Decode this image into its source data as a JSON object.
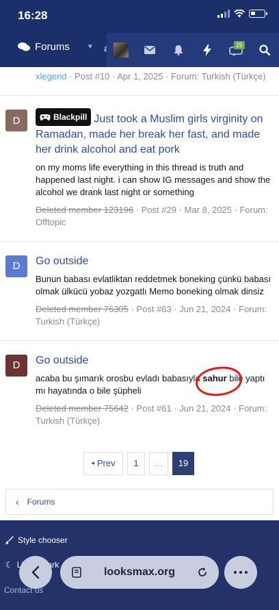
{
  "status": {
    "time": "16:28"
  },
  "nav": {
    "forums_label": "Forums",
    "extra_char": "a",
    "badge_count": "25"
  },
  "prev_post": {
    "user": "xlegend",
    "meta": " · Post #10 · Apr 1, 2025 · Forum: Turkish (Türkçe)"
  },
  "posts": [
    {
      "avatar_letter": "D",
      "avatar_color": "#8a6a5e",
      "prefix_label": "Blackpill",
      "title": "Just took a Muslim girls virginity on Ramadan, made her break her fast, and made her drink alcohol and eat pork",
      "snippet": "on my moms life everything in this thread is truth and happened last night. i can show IG messages and show the alcohol we drank last night or something",
      "author": "Deleted member 123196",
      "meta": " · Post #29 · Mar 8, 2025 · Forum: Offtopic"
    },
    {
      "avatar_letter": "D",
      "avatar_color": "#5a7bd0",
      "title": "Go outside",
      "snippet": "Bunun babası evlatliktan reddetmek boneking çünkü babası olmak ülkücü yobaz yozgatlı Memo boneking olmak dinsiz",
      "author": "Deleted member 76305",
      "meta": " · Post #63 · Jun 21, 2024 · Forum: Turkish (Türkçe)"
    },
    {
      "avatar_letter": "D",
      "avatar_color": "#6b3430",
      "title": "Go outside",
      "snippet_before": "acaba bu şımarık orosbu evladı babasıyla ",
      "snippet_highlight": "sahur",
      "snippet_after": " bile yaptı mı hayatında o bile şüpheli",
      "author": "Deleted member 75642",
      "meta": " · Post #61 · Jun 21, 2024 · Forum: Turkish (Türkçe)"
    }
  ],
  "pagination": {
    "prev": "Prev",
    "first": "1",
    "ellipsis": "…",
    "current": "19"
  },
  "breadcrumb": {
    "label": "Forums"
  },
  "footer": {
    "style_chooser": "Style chooser",
    "light_dark": "Light / Dark",
    "contact": "Contact us"
  },
  "browser": {
    "url": "looksmax.org"
  },
  "colors": {
    "nav_bg": "#1b2f6b",
    "link": "#2c4da2",
    "pager_current": "#2c4076"
  }
}
